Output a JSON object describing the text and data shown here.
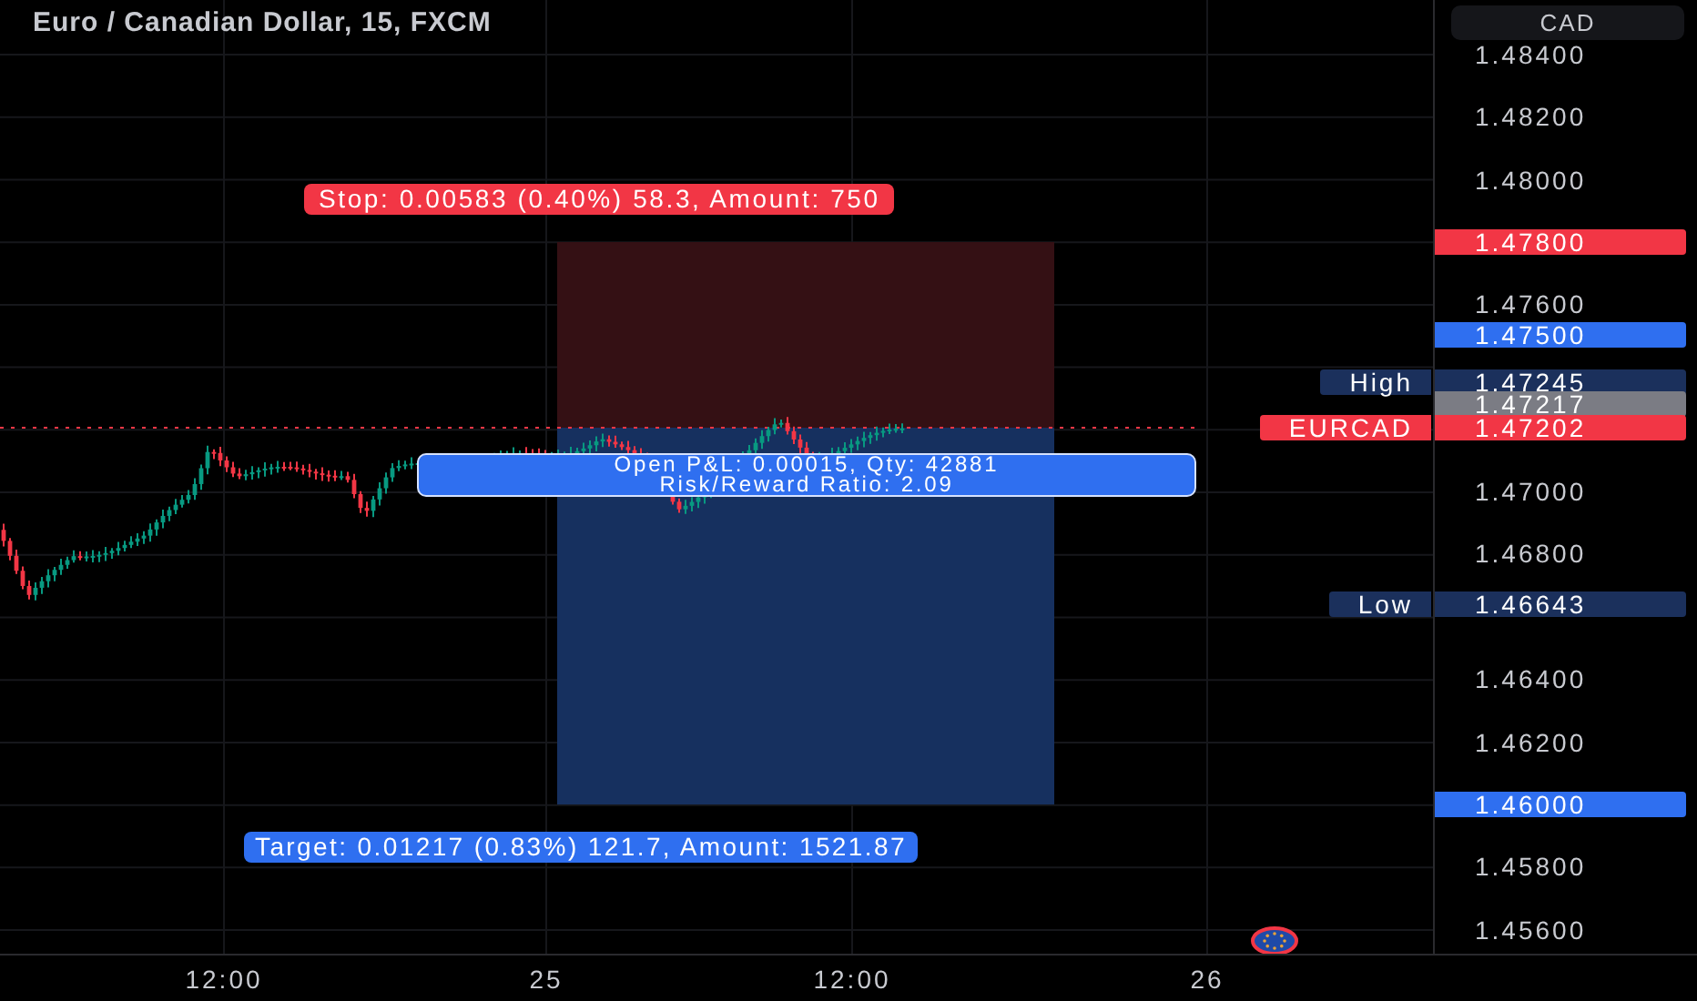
{
  "header": {
    "title": "Euro / Canadian Dollar, 15, FXCM",
    "currency_button": "CAD"
  },
  "price_axis": {
    "ticks": [
      "1.48400",
      "1.48200",
      "1.48000",
      "1.47600",
      "1.47000",
      "1.46800",
      "1.46400",
      "1.46200",
      "1.45800",
      "1.45600"
    ]
  },
  "price_labels": [
    {
      "value": "1.47800",
      "color": "#f23645"
    },
    {
      "value": "1.47500",
      "color": "#2f6ff0"
    },
    {
      "tag": "High",
      "value": "1.47245",
      "color": "#1b305c"
    },
    {
      "value": "1.47217",
      "color": "#7b7c84"
    },
    {
      "tag": "EURCAD",
      "value": "1.47202",
      "color": "#f23645"
    },
    {
      "tag": "Low",
      "value": "1.46643",
      "color": "#1b305c"
    },
    {
      "value": "1.46000",
      "color": "#2f6ff0"
    }
  ],
  "position": {
    "stop_label": "Stop: 0.00583 (0.40%) 58.3, Amount: 750",
    "info_lines": [
      "Open P&L: 0.00015, Qty: 42881",
      "Risk/Reward Ratio: 2.09"
    ],
    "target_label": "Target: 0.01217 (0.83%) 121.7, Amount: 1521.87"
  },
  "time_axis": {
    "labels": [
      "12:00",
      "25",
      "12:00",
      "26"
    ]
  }
}
